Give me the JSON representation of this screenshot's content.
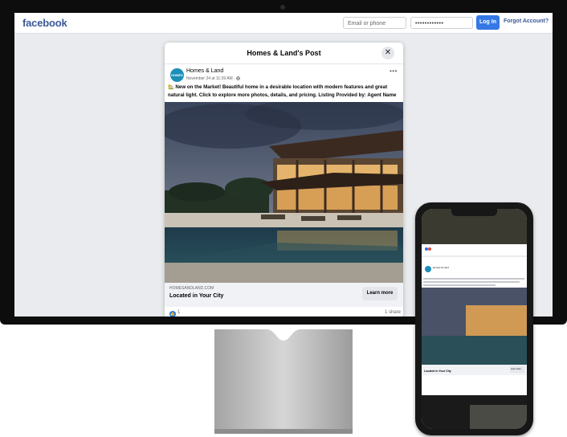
{
  "browser": {
    "logo": "facebook",
    "email_placeholder": "Email or phone",
    "password_mask": "••••••••••••",
    "login_label": "Log In",
    "forgot_label": "Forgot Account?"
  },
  "modal": {
    "title": "Homes & Land's Post",
    "close_glyph": "✕"
  },
  "post": {
    "avatar_text": "HOMES",
    "page_name": "Homes & Land",
    "date": "November 24 at 11:39 AM · ",
    "more_glyph": "•••",
    "text": "🏡 New on the Market! Beautiful home in a desirable location with modern features and great natural light. Click to explore more photos, details, and pricing. Listing Provided by: Agent Name",
    "link_domain": "HOMESANDLAND.COM",
    "link_title": "Located in Your City",
    "cta_label": "Learn more",
    "like_count": "1",
    "share_count": "1 share"
  },
  "phone_post": {
    "page_name": "Homes & Land",
    "link_title": "Located in Your City",
    "cta_label": "Learn more"
  },
  "icons": [
    "globe-icon",
    "close-icon",
    "more-icon",
    "like-icon"
  ],
  "colors": {
    "brand": "#3b5998",
    "button": "#3578e5",
    "like": "#1877f2",
    "background": "#e9ebee"
  }
}
